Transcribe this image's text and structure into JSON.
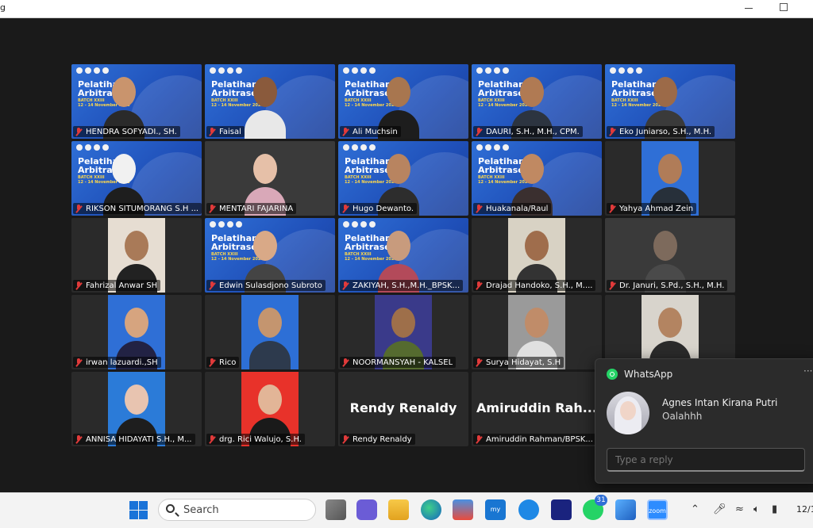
{
  "window": {
    "title": "g"
  },
  "participants": [
    {
      "name": "HENDRA SOFYADI., SH."
    },
    {
      "name": "Faisal"
    },
    {
      "name": "Ali Muchsin"
    },
    {
      "name": "DAURI, S.H., M.H., CPM."
    },
    {
      "name": "Eko Juniarso, S.H., M.H."
    },
    {
      "name": "RIKSON SITUMORANG S.H ..."
    },
    {
      "name": "MENTARI FAJARINA"
    },
    {
      "name": "Hugo Dewanto."
    },
    {
      "name": "Huakanala/Raul"
    },
    {
      "name": "Yahya Ahmad Zein"
    },
    {
      "name": "Fahrizal Anwar SH"
    },
    {
      "name": "Edwin Sulasdjono Subroto"
    },
    {
      "name": "ZAKIYAH, S.H.,M.H._BPSK..."
    },
    {
      "name": "Drajad Handoko, S.H., M...."
    },
    {
      "name": "Dr. Januri, S.Pd., S.H., M.H."
    },
    {
      "name": "irwan lazuardi.,SH"
    },
    {
      "name": "Rico"
    },
    {
      "name": "NOORMANSYAH - KALSEL"
    },
    {
      "name": "Surya Hidayat, S.H"
    },
    {
      "name": ""
    },
    {
      "name": "ANNISA HIDAYATI S.H., M..."
    },
    {
      "name": "drg. Rici Walujo, S.H."
    },
    {
      "name": "Rendy Renaldy",
      "big": "Rendy Renaldy"
    },
    {
      "name": "Amiruddin Rahman/BPSK...",
      "big": "Amiruddin  Rah..."
    }
  ],
  "banner": {
    "line1": "Pelatihan",
    "line2": "Arbitrase",
    "line3": "BATCH XXIII",
    "dates": "12 - 14 November 2023"
  },
  "notification": {
    "app": "WhatsApp",
    "more": "···",
    "sender": "Agnes Intan Kirana Putri",
    "message": "Oalahhh",
    "reply_placeholder": "Type a reply"
  },
  "taskbar": {
    "search_label": "Search",
    "whatsapp_badge": "31",
    "zoom_label": "zoom",
    "clock": "12/1"
  }
}
